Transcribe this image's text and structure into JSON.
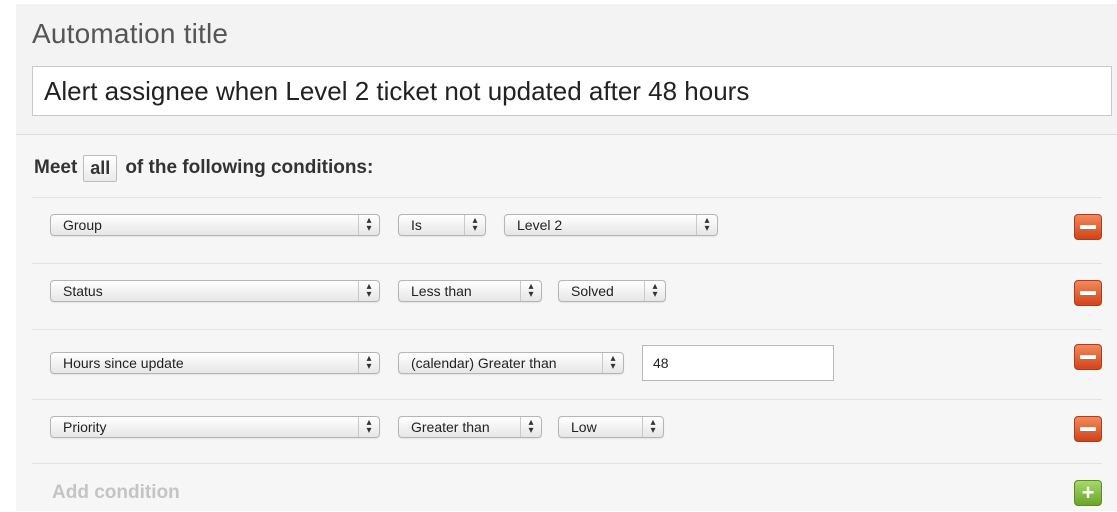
{
  "automation": {
    "title_label": "Automation title",
    "title_value": "Alert assignee when Level 2 ticket not updated after 48 hours"
  },
  "conditions": {
    "meet_prefix": "Meet",
    "meet_value": "all",
    "meet_suffix": "of the following conditions:",
    "rows": [
      {
        "field": "Group",
        "operator": "Is",
        "value": "Level 2"
      },
      {
        "field": "Status",
        "operator": "Less than",
        "value": "Solved"
      },
      {
        "field": "Hours since update",
        "operator": "(calendar) Greater than",
        "value": "48"
      },
      {
        "field": "Priority",
        "operator": "Greater than",
        "value": "Low"
      }
    ],
    "add_label": "Add condition"
  },
  "icons": {
    "remove": "minus-icon",
    "add": "plus-icon",
    "select_arrows": "updown-arrows-icon"
  },
  "colors": {
    "remove_button": "#d9532a",
    "add_button": "#7db83a",
    "add_label": "#c4c4c4"
  }
}
